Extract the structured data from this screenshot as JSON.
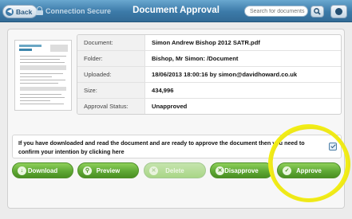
{
  "header": {
    "back_label": "Back",
    "connection_label": "Connection Secure",
    "title": "Document Approval",
    "search_placeholder": "Search for documents"
  },
  "document": {
    "rows": [
      {
        "label": "Document:",
        "value": "Simon Andrew Bishop 2012 SATR.pdf"
      },
      {
        "label": "Folder:",
        "value": "Bishop, Mr Simon: /Document"
      },
      {
        "label": "Uploaded:",
        "value": "18/06/2013 18:00:16 by simon@davidhoward.co.uk"
      },
      {
        "label": "Size:",
        "value": "434,996"
      },
      {
        "label": "Approval Status:",
        "value": "Unapproved"
      }
    ]
  },
  "confirm": {
    "text": "If you have downloaded and read the document and are ready to approve the document then you need to confirm your intention by clicking here",
    "checked": true
  },
  "actions": {
    "download": "Download",
    "preview": "Preview",
    "delete": "Delete",
    "disapprove": "Disapprove",
    "approve": "Approve"
  },
  "colors": {
    "header": "#3c7aa8",
    "button_green": "#5fa835",
    "annotation_yellow": "#f2ee14"
  }
}
